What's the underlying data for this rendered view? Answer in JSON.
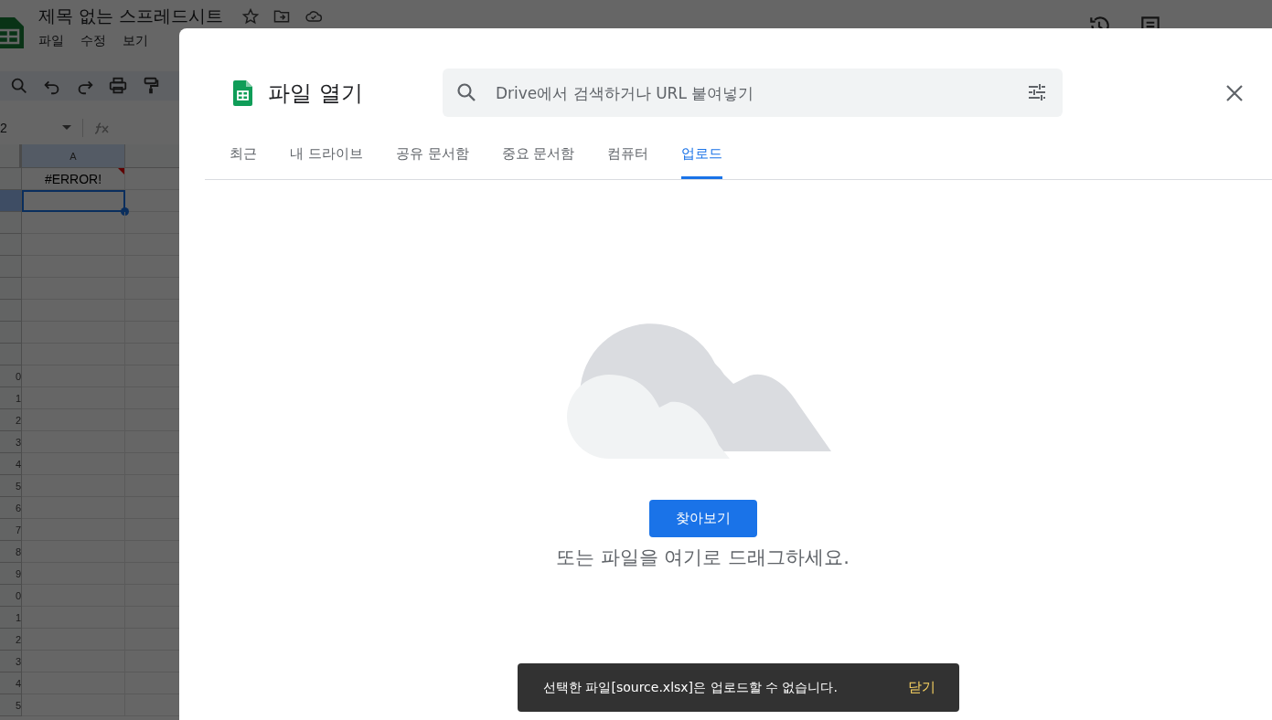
{
  "spreadsheet": {
    "title": "제목 없는 스프레드시트",
    "menu": [
      "파일",
      "수정",
      "보기"
    ],
    "name_box": "2",
    "columns": [
      {
        "label": "A",
        "selected": true
      }
    ],
    "rows": [
      {
        "value": "#ERROR!",
        "error": true,
        "selected": false
      },
      {
        "selected": true
      },
      {
        "selected": false
      },
      {
        "selected": false
      },
      {
        "selected": false
      },
      {
        "selected": false
      },
      {
        "selected": false
      },
      {
        "selected": false
      },
      {
        "selected": false
      },
      {
        "label": "0",
        "selected": false
      },
      {
        "label": "1",
        "selected": false
      },
      {
        "label": "2",
        "selected": false
      },
      {
        "label": "3",
        "selected": false
      },
      {
        "label": "4",
        "selected": false
      },
      {
        "label": "5",
        "selected": false
      },
      {
        "label": "6",
        "selected": false
      },
      {
        "label": "7",
        "selected": false
      },
      {
        "label": "8",
        "selected": false
      },
      {
        "label": "9",
        "selected": false
      },
      {
        "label": "0",
        "selected": false
      },
      {
        "label": "1",
        "selected": false
      },
      {
        "label": "2",
        "selected": false
      },
      {
        "label": "3",
        "selected": false
      },
      {
        "label": "4",
        "selected": false
      },
      {
        "label": "5",
        "selected": false
      }
    ]
  },
  "dialog": {
    "title": "파일 열기",
    "search": {
      "placeholder": "Drive에서 검색하거나 URL 붙여넣기"
    },
    "tabs": [
      {
        "label": "최근",
        "selected": false
      },
      {
        "label": "내 드라이브",
        "selected": false
      },
      {
        "label": "공유 문서함",
        "selected": false
      },
      {
        "label": "중요 문서함",
        "selected": false
      },
      {
        "label": "컴퓨터",
        "selected": false
      },
      {
        "label": "업로드",
        "selected": true
      }
    ],
    "browse_button": "찾아보기",
    "drop_hint": "또는 파일을 여기로 드래그하세요."
  },
  "snackbar": {
    "message": "선택한 파일[source.xlsx]은 업로드할 수 없습니다.",
    "action": "닫기"
  }
}
